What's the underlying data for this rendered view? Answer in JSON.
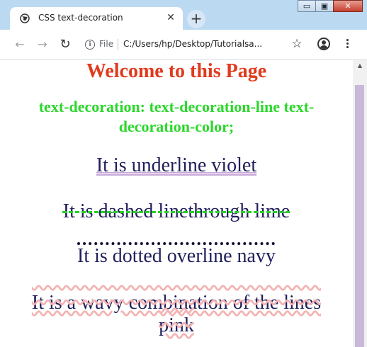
{
  "browser": {
    "tab": {
      "title": "CSS text-decoration",
      "favicon": "globe-icon",
      "close_glyph": "✕"
    },
    "new_tab_glyph": "+",
    "window_controls": {
      "minimize_glyph": "▭",
      "maximize_glyph": "▣",
      "close_glyph": "✕"
    },
    "toolbar": {
      "back_glyph": "←",
      "forward_glyph": "→",
      "reload_glyph": "↻",
      "info_glyph": "i",
      "scheme_label": "File",
      "url": "C:/Users/hp/Desktop/Tutorialsa...",
      "star_glyph": "☆"
    },
    "scrollbar": {
      "up_glyph": "▲"
    }
  },
  "page": {
    "title": "Welcome to this Page",
    "subtitle": "text-decoration: text-decoration-line text-decoration-color;",
    "demos": {
      "underline": "It is underline violet",
      "linethrough": "It is dashed linethrough lime",
      "overline": "It is dotted overline navy",
      "wavy": "It is a wavy combination of the lines pink"
    }
  },
  "colors": {
    "title": "#e03a1c",
    "subtitle": "#2bd72b",
    "body_text": "#1f1f5c",
    "underline_violet": "#c9a9d9",
    "linethrough_lime": "#22d422",
    "overline_navy": "#111133",
    "wavy_pink": "#f3b3b3",
    "chrome_bg": "#bcd9f2"
  }
}
